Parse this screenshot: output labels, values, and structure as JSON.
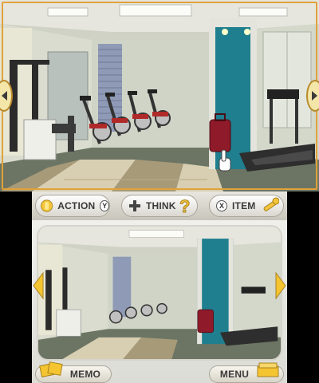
{
  "toolbar": {
    "action_label": "ACTION",
    "action_key": "Y",
    "think_label": "THINK",
    "item_label": "ITEM",
    "item_key": "X"
  },
  "bottom_bar": {
    "memo_label": "MEMO",
    "menu_label": "MENU"
  },
  "colors": {
    "accent_gold": "#e0a23a",
    "teal_pillar": "#1f7f8f",
    "suitcase": "#8e1a2a",
    "floor_tile_light": "#d8cfb2",
    "floor_tile_dark": "#a79a78"
  },
  "scene": {
    "room": "gym",
    "objects": [
      "weight-machine",
      "exercise-bike",
      "exercise-bike",
      "exercise-bike",
      "exercise-bike",
      "teal-pillar",
      "red-suitcase",
      "treadmill",
      "window-blind"
    ]
  }
}
